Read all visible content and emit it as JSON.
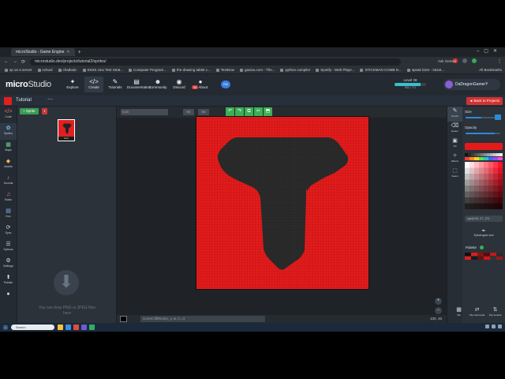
{
  "browser": {
    "tab_title": "microStudio - Game Engine",
    "url": "microstudio.dev/projects/tutorial2/sprites/",
    "ask_label": "Ask Gemini",
    "all_bookmarks": "All Bookmarks",
    "bookmarks": [
      "sp on a server",
      "school",
      "chatbotic",
      "SSSS Uno Test Strat...",
      "Computer Program...",
      "the drawing tablet c...",
      "TextNow",
      "gaviao.com - The...",
      "python compiler",
      "Spotify - Web Playe...",
      "STICKMAN COMB D...",
      "speak lotze - lotzet..."
    ]
  },
  "header": {
    "logo_bold": "micro",
    "logo_light": "Studio",
    "nav": [
      {
        "label": "Explore",
        "icon": "✦"
      },
      {
        "label": "Create",
        "icon": "</>"
      },
      {
        "label": "Tutorials",
        "icon": "✎"
      },
      {
        "label": "Documentation",
        "icon": "▤"
      },
      {
        "label": "Community",
        "icon": "☻"
      },
      {
        "label": "Discord",
        "icon": "◉"
      },
      {
        "label": "About",
        "icon": "●"
      }
    ],
    "about_badge": "20",
    "lang": "EN",
    "level_label": "Level 28",
    "level_xp": "583 / 711",
    "level_progress": 0.82,
    "username": "DaDragonGamerY"
  },
  "project": {
    "name": "Tutorial",
    "back_label": "◄ Back to Projects"
  },
  "sidebar": [
    {
      "label": "Code",
      "icon": "</>",
      "cls": "code"
    },
    {
      "label": "Sprites",
      "icon": "✿",
      "cls": "spr"
    },
    {
      "label": "Maps",
      "icon": "▦",
      "cls": "map"
    },
    {
      "label": "Assets",
      "icon": "◆",
      "cls": "ast"
    },
    {
      "label": "Sounds",
      "icon": "♪",
      "cls": "snd"
    },
    {
      "label": "Music",
      "icon": "♫",
      "cls": "snd"
    },
    {
      "label": "Doc",
      "icon": "▤",
      "cls": "doc"
    },
    {
      "label": "Sync",
      "icon": "⟳",
      "cls": ""
    },
    {
      "label": "Options",
      "icon": "☰",
      "cls": ""
    },
    {
      "label": "Settings",
      "icon": "⚙",
      "cls": ""
    },
    {
      "label": "Publish",
      "icon": "⬆",
      "cls": ""
    },
    {
      "label": "",
      "icon": "●",
      "cls": ""
    }
  ],
  "sprites": {
    "add_label": "+ Sprite",
    "thumb_label": "icon",
    "drop_text_1": "You can drop PNG or JPEG files",
    "drop_text_2": "here"
  },
  "editor": {
    "name_placeholder": "icon",
    "width": "64",
    "height": "64",
    "tools": [
      "↶",
      "↷",
      "⧉",
      "✂",
      "⬒"
    ],
    "command": "screen.fillRect(x, y, w, h, c)",
    "coords": "100, 46"
  },
  "tools": [
    {
      "label": "Pencil",
      "icon": "✎"
    },
    {
      "label": "Eraser",
      "icon": "⌫"
    },
    {
      "label": "Fill",
      "icon": "▣"
    },
    {
      "label": "Effects",
      "icon": "✧"
    },
    {
      "label": "Select",
      "icon": "⬚"
    }
  ],
  "props": {
    "size_label": "Size",
    "opacity_label": "Opacity",
    "size_value": 0.45,
    "opacity_value": 0.85,
    "color": "#e41b1b",
    "hex": "rgb(228, 27, 27)",
    "eyedropper_label": "Eyedropper tool",
    "palette_label": "Palette"
  },
  "bottom_buttons": [
    {
      "label": "Tile",
      "icon": "▦"
    },
    {
      "label": "Flip Horizontal",
      "icon": "⇄"
    },
    {
      "label": "Flip Vertical",
      "icon": "⇅"
    }
  ],
  "taskbar": {
    "search_placeholder": "Search"
  },
  "colors": {
    "sprite_bg": "#e41b1b",
    "sprite_shape": "#2b2b2b",
    "accent_green": "#3bb055",
    "accent_red": "#d23232"
  }
}
